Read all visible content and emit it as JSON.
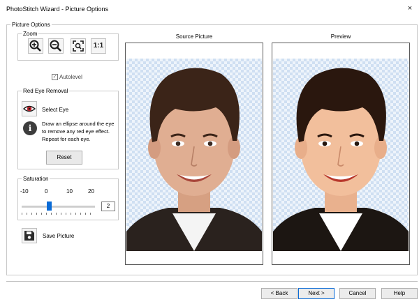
{
  "window": {
    "title": "PhotoStitch Wizard - Picture Options",
    "close": "×"
  },
  "picture_options": {
    "legend": "Picture Options"
  },
  "zoom": {
    "legend": "Zoom",
    "one_to_one_label": "1:1",
    "icons": [
      "zoom-in-icon",
      "zoom-out-icon",
      "zoom-fit-icon",
      "zoom-actual-size-icon"
    ]
  },
  "autolevel": {
    "label": "Autolevel",
    "checked": true,
    "check_mark": "✓"
  },
  "red_eye": {
    "legend": "Red Eye Removal",
    "select_label": "Select Eye",
    "info_glyph": "i",
    "info_text": "Draw an ellipse around the eye to remove any red eye effect. Repeat for each eye.",
    "reset_label": "Reset"
  },
  "saturation": {
    "legend": "Saturation",
    "ticks": [
      "-10",
      "0",
      "10",
      "20"
    ],
    "value": "2",
    "min": -10,
    "max": 20,
    "current": 2
  },
  "save": {
    "label": "Save Picture"
  },
  "panels": {
    "source_title": "Source Picture",
    "preview_title": "Preview"
  },
  "footer": {
    "back": "< Back",
    "next": "Next >",
    "cancel": "Cancel",
    "help": "Help"
  },
  "colors": {
    "accent": "#0a6bd6",
    "checker": "#cfdff2"
  }
}
